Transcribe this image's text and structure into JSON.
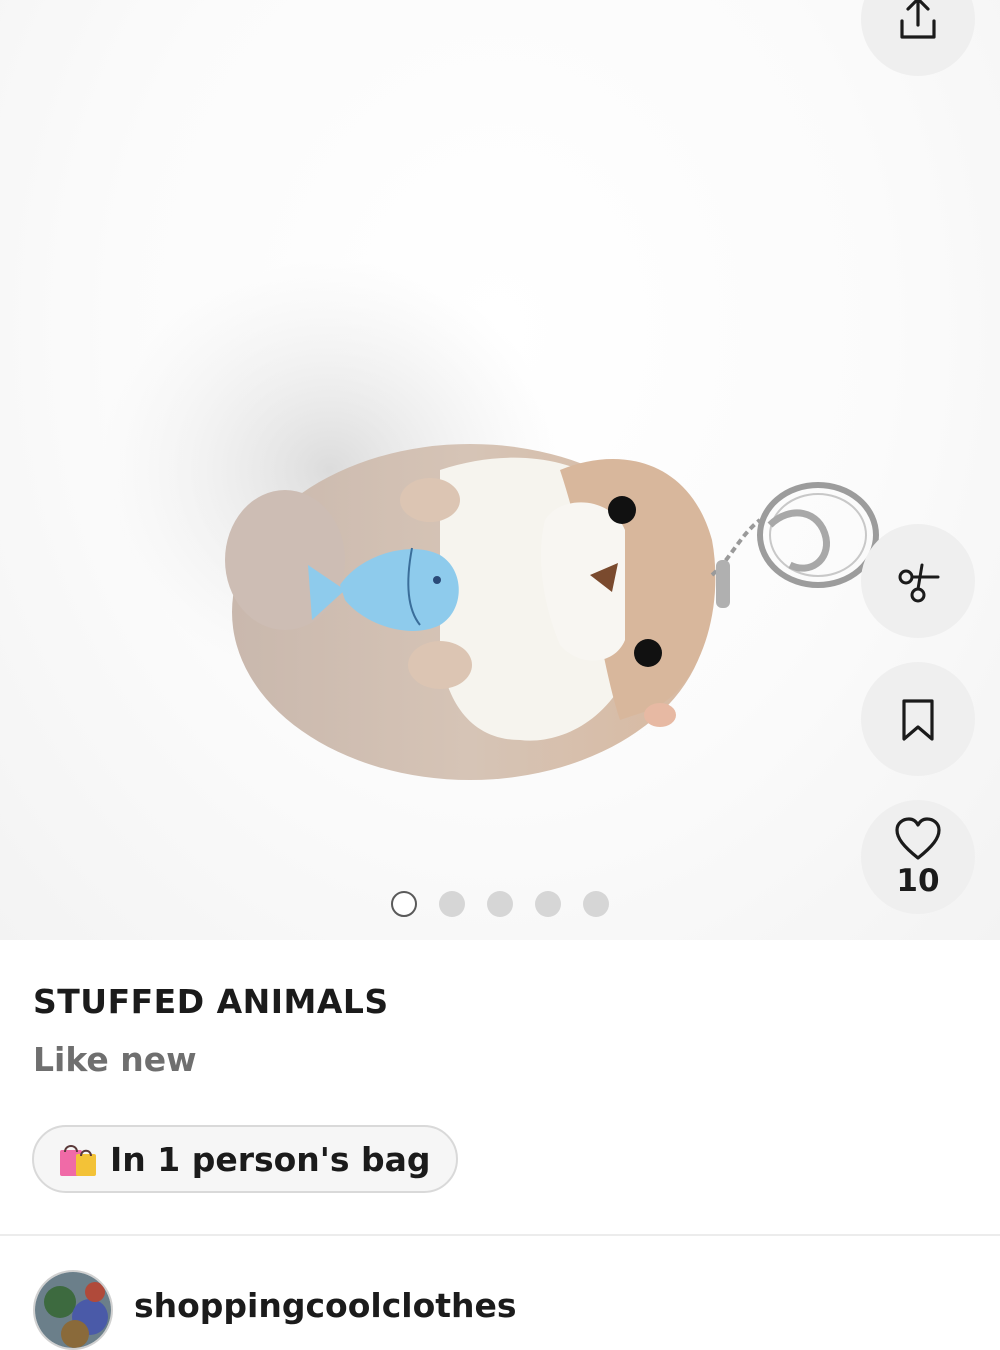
{
  "listing": {
    "title": "STUFFED ANIMALS",
    "condition": "Like new",
    "likes_count": "10",
    "bag_status": "In 1 person's bag",
    "bag_emoji": "shopping-bags-icon"
  },
  "carousel": {
    "total_images": 5,
    "active_index": 0
  },
  "seller": {
    "username": "shoppingcoolclothes"
  },
  "actions": {
    "share_icon": "share-icon",
    "offer_icon": "scissors-icon",
    "save_icon": "bookmark-icon",
    "like_icon": "heart-icon"
  },
  "colors": {
    "button_bg": "#efefef",
    "text_primary": "#1b1b1b",
    "text_secondary": "#6f6f6f"
  }
}
